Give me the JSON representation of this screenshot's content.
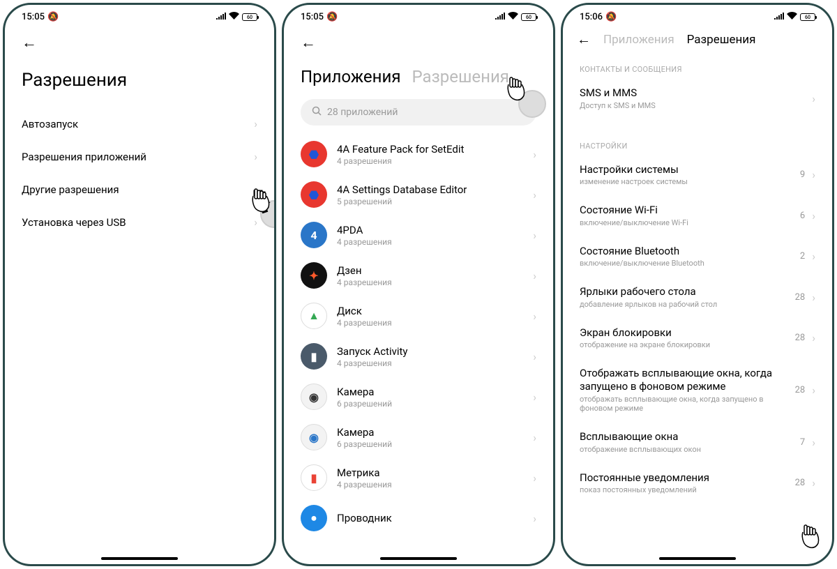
{
  "phone1": {
    "time": "15:05",
    "battery": "60",
    "title": "Разрешения",
    "items": [
      {
        "label": "Автозапуск"
      },
      {
        "label": "Разрешения приложений"
      },
      {
        "label": "Другие разрешения"
      },
      {
        "label": "Установка через USB"
      }
    ]
  },
  "phone2": {
    "time": "15:05",
    "battery": "60",
    "tab_apps": "Приложения",
    "tab_perms": "Разрешения",
    "search_placeholder": "28 приложений",
    "apps": [
      {
        "name": "4A Feature Pack for SetEdit",
        "sub": "4 разрешения",
        "bg": "#e8372f",
        "accent": "#2156d6",
        "glyph": "⬣"
      },
      {
        "name": "4A Settings Database Editor",
        "sub": "5 разрешений",
        "bg": "#e8372f",
        "accent": "#2156d6",
        "glyph": "⬣"
      },
      {
        "name": "4PDA",
        "sub": "4 разрешения",
        "bg": "#2a76c8",
        "accent": "#fff",
        "glyph": "4"
      },
      {
        "name": "Дзен",
        "sub": "4 разрешения",
        "bg": "#111",
        "accent": "#ff5a2b",
        "glyph": "✦"
      },
      {
        "name": "Диск",
        "sub": "4 разрешения",
        "bg": "#fff",
        "accent": "#34a853",
        "glyph": "▲"
      },
      {
        "name": "Запуск Activity",
        "sub": "4 разрешения",
        "bg": "#4a5a6a",
        "accent": "#fff",
        "glyph": "▮"
      },
      {
        "name": "Камера",
        "sub": "6 разрешений",
        "bg": "#f3f3f3",
        "accent": "#333",
        "glyph": "◉"
      },
      {
        "name": "Камера",
        "sub": "6 разрешений",
        "bg": "#f3f3f3",
        "accent": "#2a76c8",
        "glyph": "◉"
      },
      {
        "name": "Метрика",
        "sub": "4 разрешения",
        "bg": "#fff",
        "accent": "#ea4335",
        "glyph": "▮"
      },
      {
        "name": "Проводник",
        "sub": "",
        "bg": "#1e88e5",
        "accent": "#fff",
        "glyph": "●"
      }
    ]
  },
  "phone3": {
    "time": "15:06",
    "battery": "60",
    "tab_apps": "Приложения",
    "tab_perms": "Разрешения",
    "section_contacts": "КОНТАКТЫ И СООБЩЕНИЯ",
    "sms_title": "SMS и MMS",
    "sms_sub": "Доступ к SMS и MMS",
    "section_settings": "НАСТРОЙКИ",
    "perms": [
      {
        "title": "Настройки системы",
        "sub": "изменение настроек системы",
        "count": "9"
      },
      {
        "title": "Состояние Wi-Fi",
        "sub": "включение/выключение Wi-Fi",
        "count": "6"
      },
      {
        "title": "Состояние Bluetooth",
        "sub": "включение/выключение Bluetooth",
        "count": "2"
      },
      {
        "title": "Ярлыки рабочего стола",
        "sub": "добавление ярлыков на рабочий стол",
        "count": "28"
      },
      {
        "title": "Экран блокировки",
        "sub": "отображение на экране блокировки",
        "count": "28"
      },
      {
        "title": "Отображать всплывающие окна, когда запущено в фоновом режиме",
        "sub": "отображать всплывающие окна, когда запущено в фоновом режиме",
        "count": "28"
      },
      {
        "title": "Всплывающие окна",
        "sub": "отображение всплывающих окон",
        "count": "7"
      },
      {
        "title": "Постоянные уведомления",
        "sub": "показ постоянных уведомлений",
        "count": "28"
      }
    ]
  }
}
